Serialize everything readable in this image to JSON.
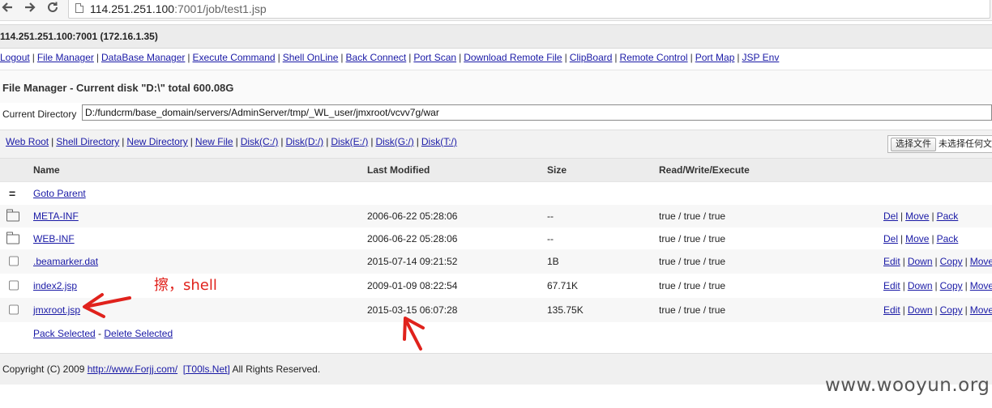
{
  "browser": {
    "url_host": "114.251.251.100",
    "url_rest": ":7001/job/test1.jsp",
    "back_icon": "arrow-left",
    "forward_icon": "arrow-right",
    "reload_icon": "reload"
  },
  "host_info": "114.251.251.100:7001 (172.16.1.35)",
  "menu": [
    "Logout",
    "File Manager",
    "DataBase Manager",
    "Execute Command",
    "Shell OnLine",
    "Back Connect",
    "Port Scan",
    "Download Remote File",
    "ClipBoard",
    "Remote Control",
    "Port Map",
    "JSP Env"
  ],
  "page_title": "File Manager - Current disk \"D:\\\" total 600.08G",
  "current_dir": {
    "label": "Current Directory",
    "value": "D:/fundcrm/base_domain/servers/AdminServer/tmp/_WL_user/jmxroot/vcvv7g/war"
  },
  "quick_links": [
    "Web Root",
    "Shell Directory",
    "New Directory",
    "New File",
    "Disk(C:/)",
    "Disk(D:/)",
    "Disk(E:/)",
    "Disk(G:/)",
    "Disk(T:/)"
  ],
  "upload": {
    "button": "选择文件",
    "status": "未选择任何文件"
  },
  "table": {
    "headers": {
      "name": "Name",
      "modified": "Last Modified",
      "size": "Size",
      "rwx": "Read/Write/Execute"
    },
    "parent": "Goto Parent",
    "rows": [
      {
        "type": "dir",
        "name": "META-INF",
        "modified": "2006-06-22 05:28:06",
        "size": "--",
        "rwx": "true / true / true",
        "actions": [
          "Del",
          "Move",
          "Pack"
        ]
      },
      {
        "type": "dir",
        "name": "WEB-INF",
        "modified": "2006-06-22 05:28:06",
        "size": "--",
        "rwx": "true / true / true",
        "actions": [
          "Del",
          "Move",
          "Pack"
        ]
      },
      {
        "type": "file",
        "name": ".beamarker.dat",
        "modified": "2015-07-14 09:21:52",
        "size": "1B",
        "rwx": "true / true / true",
        "actions": [
          "Edit",
          "Down",
          "Copy",
          "Move"
        ]
      },
      {
        "type": "file",
        "name": "index2.jsp",
        "modified": "2009-01-09 08:22:54",
        "size": "67.71K",
        "rwx": "true / true / true",
        "actions": [
          "Edit",
          "Down",
          "Copy",
          "Move"
        ]
      },
      {
        "type": "file",
        "name": "jmxroot.jsp",
        "modified": "2015-03-15 06:07:28",
        "size": "135.75K",
        "rwx": "true / true / true",
        "actions": [
          "Edit",
          "Down",
          "Copy",
          "Move"
        ]
      }
    ],
    "pack_selected": "Pack Selected",
    "delete_selected": "Delete Selected"
  },
  "footer": {
    "prefix": "Copyright (C) 2009",
    "link1": "http://www.Forjj.com/",
    "link2": "[T00ls.Net]",
    "suffix": "All Rights Reserved."
  },
  "annotation": {
    "text": "擦，shell",
    "color": "#e0221c"
  },
  "watermark": "www.wooyun.org"
}
